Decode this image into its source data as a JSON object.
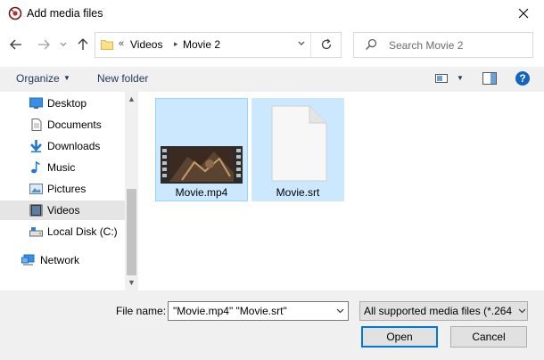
{
  "window": {
    "title": "Add media files"
  },
  "address": {
    "overflow": "«",
    "crumbs": [
      "Videos",
      "Movie 2"
    ]
  },
  "search": {
    "placeholder": "Search Movie 2"
  },
  "toolbar": {
    "organize_label": "Organize",
    "new_folder_label": "New folder"
  },
  "nav": {
    "items": [
      {
        "label": "Desktop",
        "icon": "desktop-icon"
      },
      {
        "label": "Documents",
        "icon": "documents-icon"
      },
      {
        "label": "Downloads",
        "icon": "downloads-icon"
      },
      {
        "label": "Music",
        "icon": "music-icon"
      },
      {
        "label": "Pictures",
        "icon": "pictures-icon"
      },
      {
        "label": "Videos",
        "icon": "videos-icon",
        "selected": true
      },
      {
        "label": "Local Disk (C:)",
        "icon": "drive-icon"
      },
      {
        "label": "Network",
        "icon": "network-icon"
      }
    ]
  },
  "files": [
    {
      "name": "Movie.mp4",
      "icon": "video-thumbnail",
      "selected": true
    },
    {
      "name": "Movie.srt",
      "icon": "document-icon",
      "selected": true
    }
  ],
  "footer": {
    "file_name_label": "File name:",
    "file_name_value": "\"Movie.mp4\" \"Movie.srt\"",
    "file_type_value": "All supported media files (*.264",
    "open_label": "Open",
    "cancel_label": "Cancel"
  },
  "colors": {
    "accent": "#0078d7",
    "selection": "#cce8ff",
    "selection_border": "#99d1ff",
    "help": "#1565c0"
  }
}
